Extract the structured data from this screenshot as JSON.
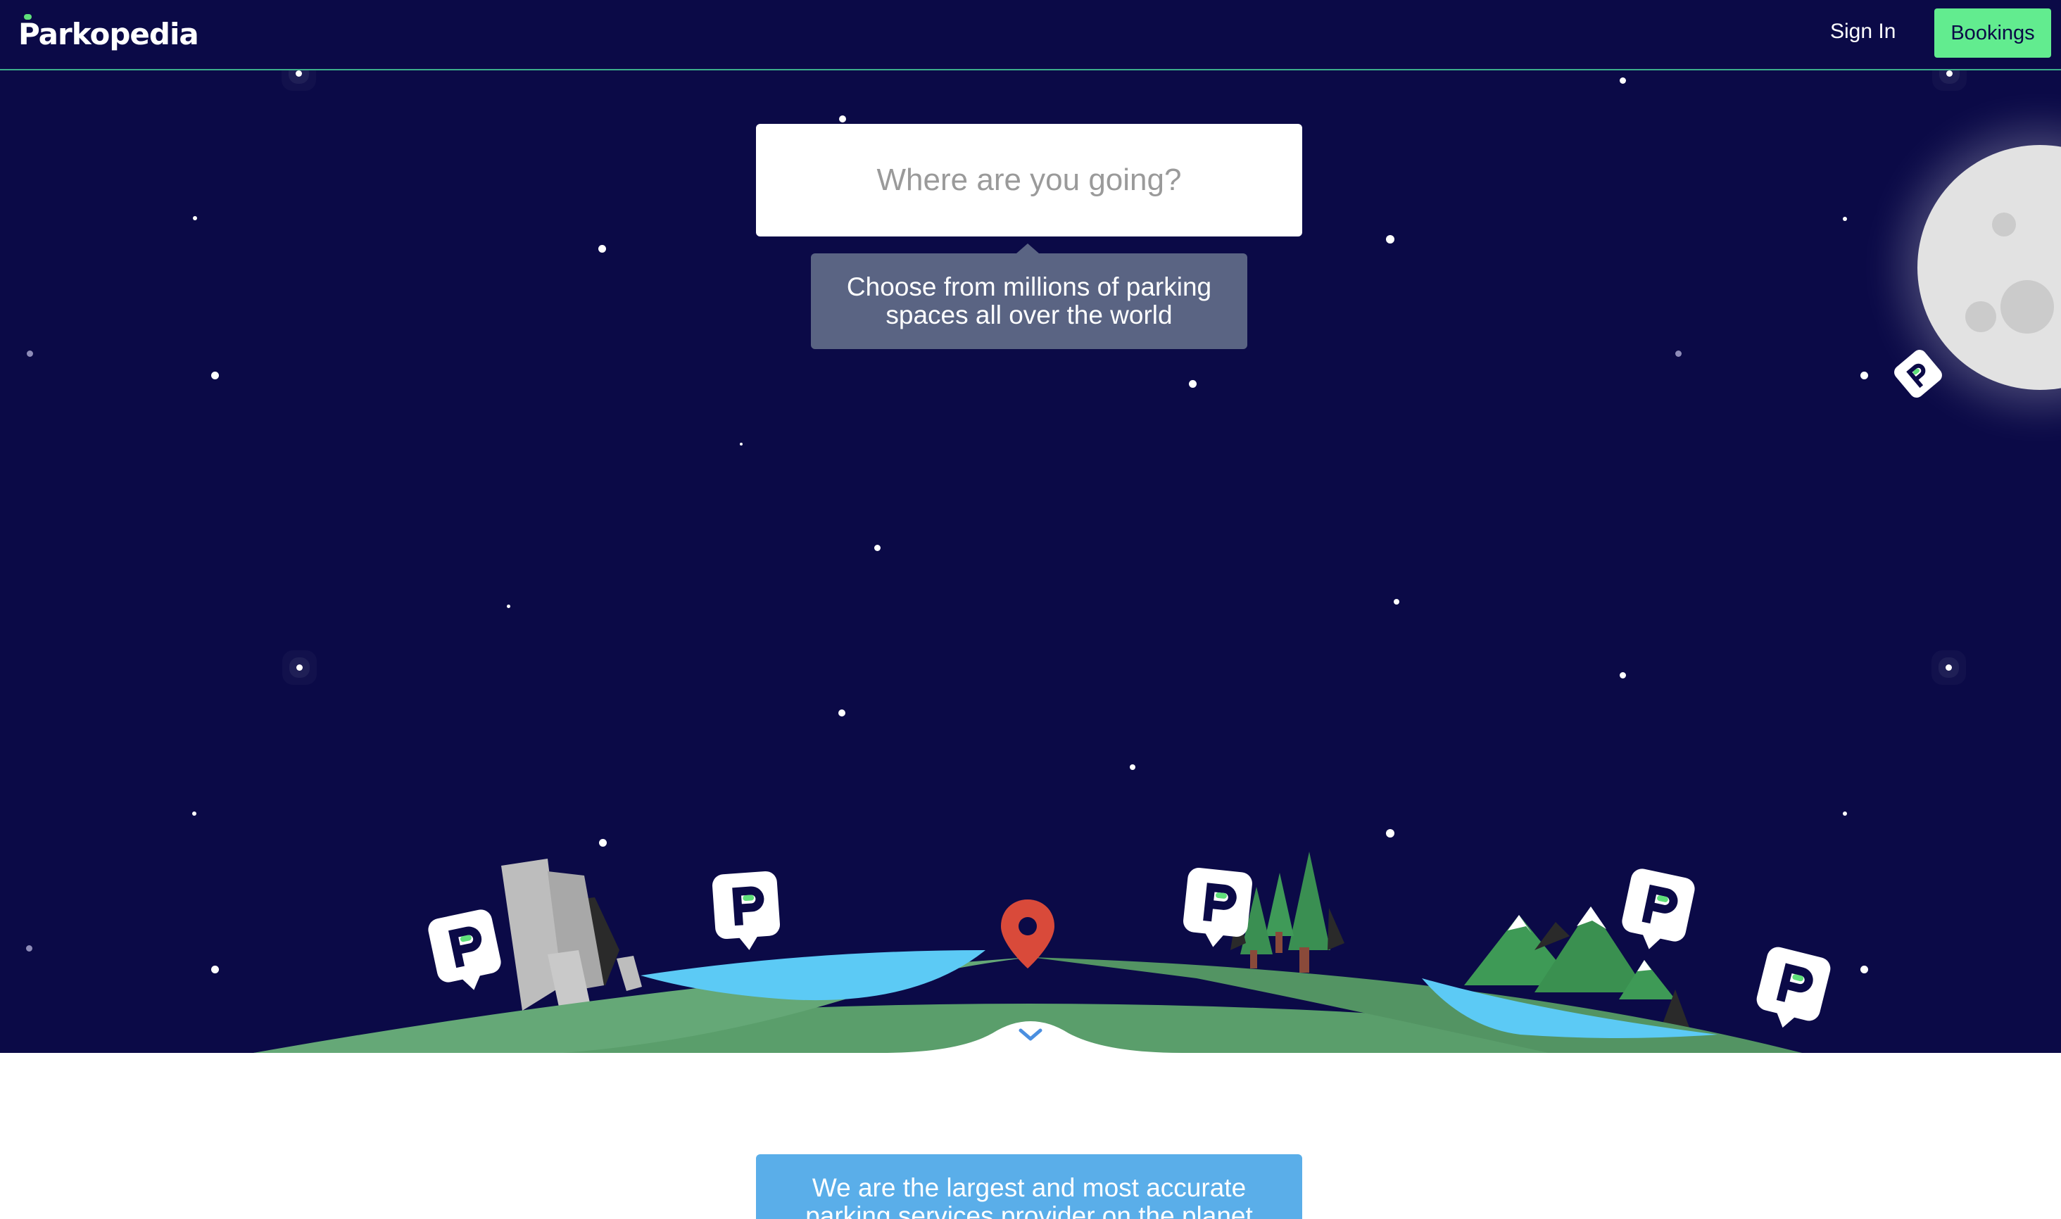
{
  "header": {
    "logo_text": "Parkopedia",
    "signin_label": "Sign In",
    "bookings_label": "Bookings"
  },
  "search": {
    "placeholder": "Where are you going?"
  },
  "tooltip": {
    "text": "Choose from millions of parking spaces all over the world"
  },
  "banner": {
    "text": "We are the largest and most accurate parking services provider on the planet"
  },
  "colors": {
    "navy": "#0b0a47",
    "accent_green": "#62ec8f",
    "tooltip_bg": "#5a6483",
    "banner_blue": "#5aaee9",
    "pin_red": "#d94a3a",
    "land_green": "#5a9e6b",
    "water_blue": "#5ccaf5"
  },
  "icons": [
    "parking-marker-icon",
    "location-pin-icon",
    "chevron-down-icon",
    "moon-icon"
  ]
}
